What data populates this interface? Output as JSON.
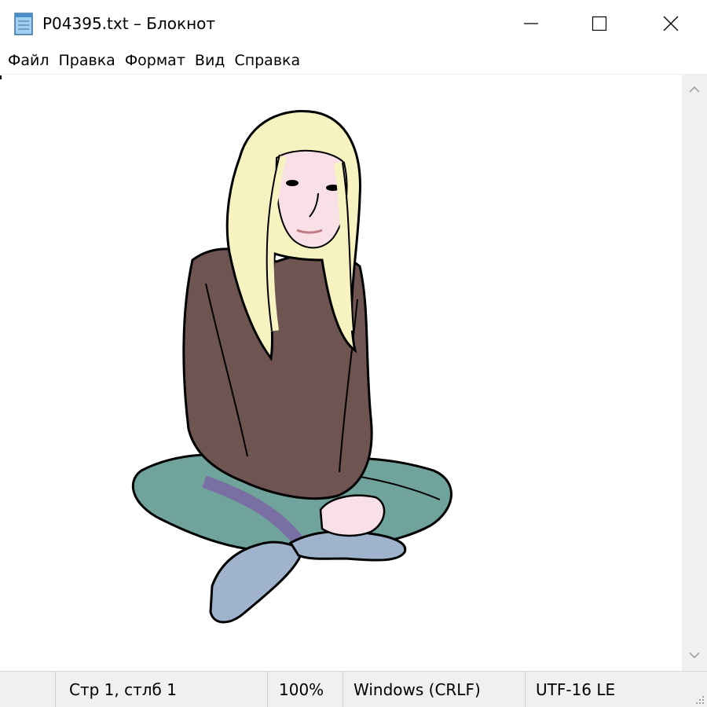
{
  "window": {
    "title": "P04395.txt – Блокнот",
    "app_icon": "notepad-icon",
    "controls": {
      "minimize": "minimize-icon",
      "maximize": "maximize-icon",
      "close": "close-icon"
    }
  },
  "menu": {
    "items": [
      {
        "label": "Файл"
      },
      {
        "label": "Правка"
      },
      {
        "label": "Формат"
      },
      {
        "label": "Вид"
      },
      {
        "label": "Справка"
      }
    ]
  },
  "editor": {
    "content_image": "seated-girl-clipart",
    "colors": {
      "hair": "#f7f3c0",
      "skin": "#f8e0e6",
      "sweater": "#6e5552",
      "pants": "#6fa39c",
      "socks": "#9fb4cc",
      "shadow": "#7a6fa2",
      "outline": "#000000"
    }
  },
  "status": {
    "position": "Стр 1, стлб 1",
    "zoom": "100%",
    "line_endings": "Windows (CRLF)",
    "encoding": "UTF-16 LE"
  }
}
